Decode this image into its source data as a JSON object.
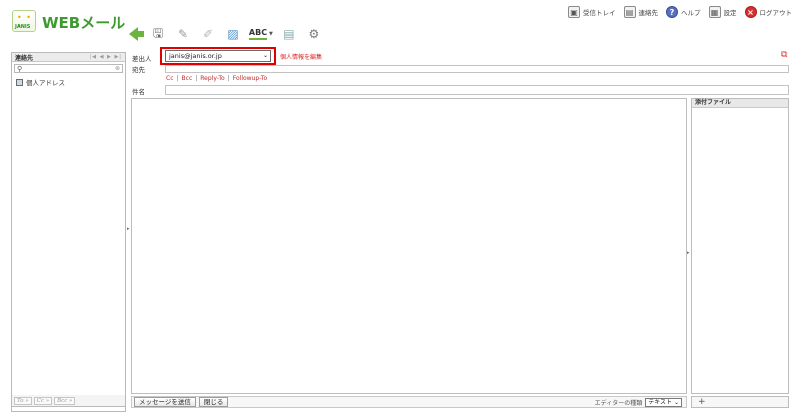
{
  "app": {
    "logo_dots": "• • •",
    "logo_sub": "JANIS",
    "title": "WEBメール"
  },
  "topnav": {
    "inbox": "受信トレイ",
    "contacts": "連絡先",
    "help": "ヘルプ",
    "settings": "設定",
    "logout": "ログアウト"
  },
  "toolbar": {
    "spellcheck_label": "ABC"
  },
  "left_panel": {
    "title": "連絡先",
    "pager": "|◀ ◀ ▶ ▶|",
    "search_icon": "search-icon",
    "address_book": "個人アドレス",
    "footer_buttons": [
      "To »",
      "Cc »",
      "Bcc »"
    ]
  },
  "compose": {
    "from_label": "差出人",
    "from_value": "janis@janis.or.jp",
    "personal_edit": "個人情報を編集",
    "to_label": "宛先",
    "cc_links": [
      "Cc",
      "Bcc",
      "Reply-To",
      "Followup-To"
    ],
    "subject_label": "件名",
    "to_value": "",
    "subject_value": ""
  },
  "attachments": {
    "title": "添付ファイル",
    "add": "+"
  },
  "bottom": {
    "send": "メッセージを送信",
    "close": "閉じる",
    "editor_label": "エディターの種類",
    "editor_value": "テキスト"
  },
  "colors": {
    "brand_green": "#3c9a2e",
    "highlight_red": "#e00000",
    "link_red": "#c62828"
  }
}
